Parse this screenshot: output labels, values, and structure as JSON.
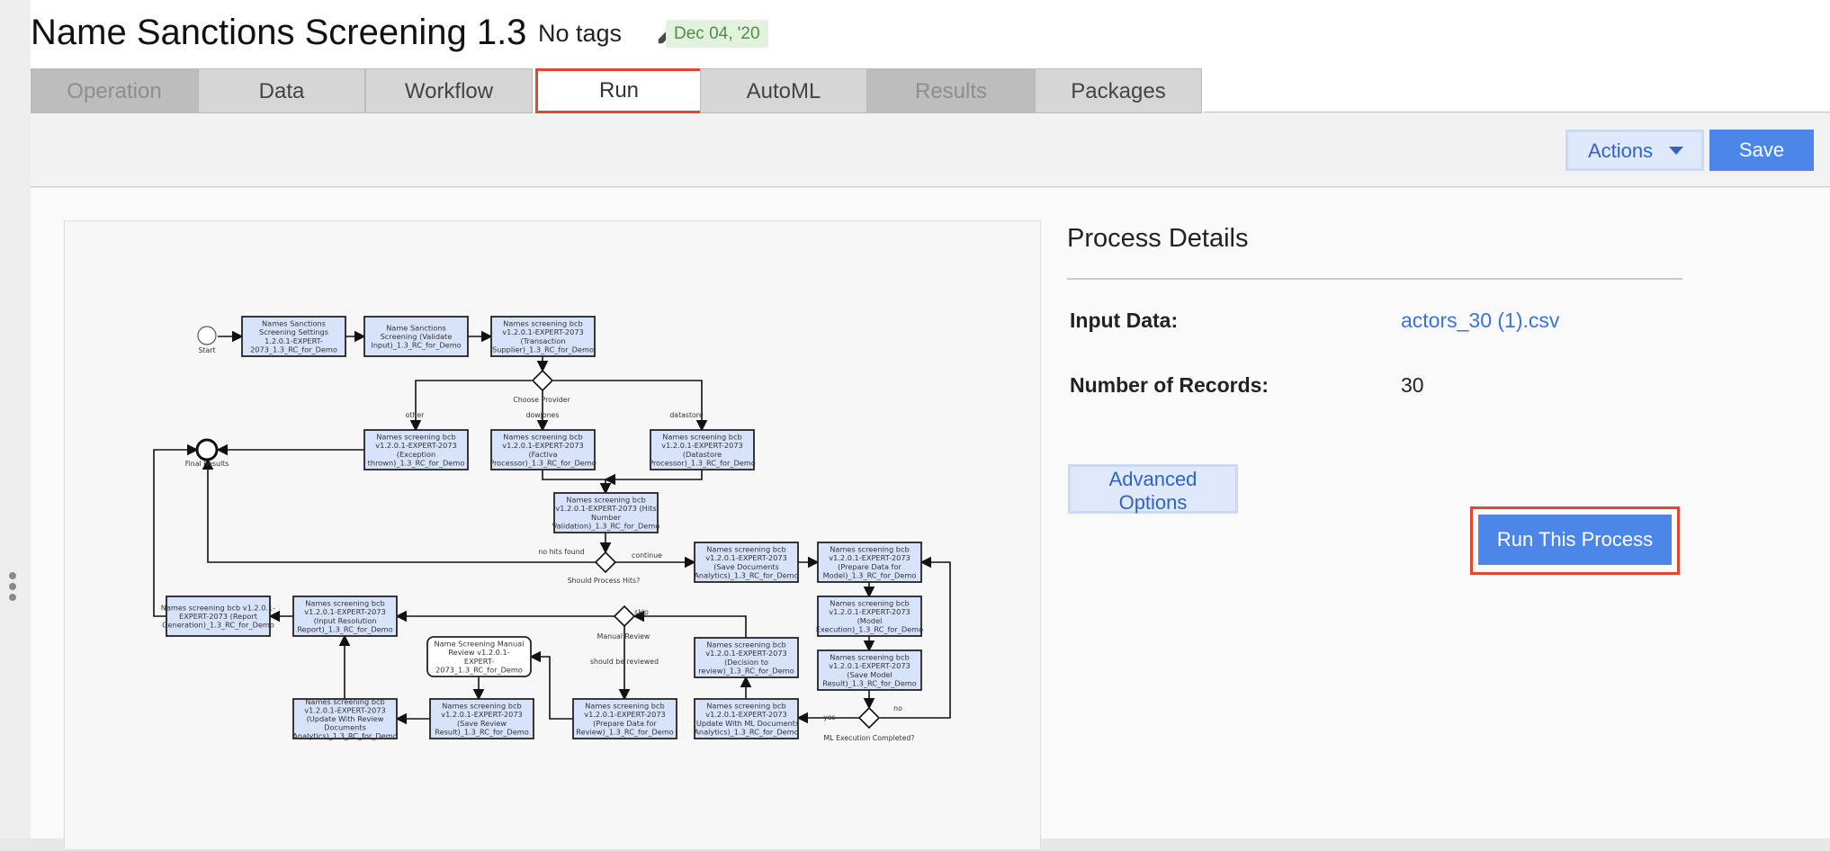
{
  "header": {
    "title": "Name Sanctions Screening 1.3",
    "tags_label": "No tags",
    "date_badge": "Dec 04, '20"
  },
  "tabs": [
    {
      "label": "Operation",
      "state": "disabled"
    },
    {
      "label": "Data",
      "state": "normal"
    },
    {
      "label": "Workflow",
      "state": "normal"
    },
    {
      "label": "Run",
      "state": "active"
    },
    {
      "label": "AutoML",
      "state": "normal"
    },
    {
      "label": "Results",
      "state": "disabled"
    },
    {
      "label": "Packages",
      "state": "normal"
    }
  ],
  "toolbar": {
    "actions_label": "Actions",
    "save_label": "Save"
  },
  "details": {
    "title": "Process Details",
    "input_label": "Input Data:",
    "input_value": "actors_30 (1).csv",
    "records_label": "Number of Records:",
    "records_value": "30",
    "advanced_label": "Advanced Options",
    "run_label": "Run This Process"
  },
  "diagram": {
    "nodes": [
      {
        "id": "settings",
        "lines": [
          "Names Sanctions",
          "Screening Settings",
          "1.2.0.1-EXPERT-",
          "2073_1.3_RC_for_Demo"
        ]
      },
      {
        "id": "validate",
        "lines": [
          "Name Sanctions",
          "Screening (Validate",
          "Input)_1.3_RC_for_Demo"
        ]
      },
      {
        "id": "transaction",
        "lines": [
          "Names screening bcb",
          "v1.2.0.1-EXPERT-2073",
          "(Transaction",
          "Supplier)_1.3_RC_for_Demo"
        ]
      },
      {
        "id": "exception",
        "lines": [
          "Names screening bcb",
          "v1.2.0.1-EXPERT-2073",
          "(Exception",
          "thrown)_1.3_RC_for_Demo"
        ]
      },
      {
        "id": "factiva",
        "lines": [
          "Names screening bcb",
          "v1.2.0.1-EXPERT-2073",
          "(Factiva",
          "Processor)_1.3_RC_for_Demo"
        ]
      },
      {
        "id": "datastore",
        "lines": [
          "Names screening bcb",
          "v1.2.0.1-EXPERT-2073",
          "(Datastore",
          "Processor)_1.3_RC_for_Demo"
        ]
      },
      {
        "id": "hits",
        "lines": [
          "Names screening bcb",
          "v1.2.0.1-EXPERT-2073 (Hits",
          "Number",
          "Validation)_1.3_RC_for_Demo"
        ]
      },
      {
        "id": "savedocs",
        "lines": [
          "Names screening bcb",
          "v1.2.0.1-EXPERT-2073",
          "(Save Documents",
          "Analytics)_1.3_RC_for_Demo"
        ]
      },
      {
        "id": "prepmodel",
        "lines": [
          "Names screening bcb",
          "v1.2.0.1-EXPERT-2073",
          "(Prepare Data for",
          "Model)_1.3_RC_for_Demo"
        ]
      },
      {
        "id": "modelexec",
        "lines": [
          "Names screening bcb",
          "v1.2.0.1-EXPERT-2073",
          "(Model",
          "Execution)_1.3_RC_for_Demo"
        ]
      },
      {
        "id": "savemodel",
        "lines": [
          "Names screening bcb",
          "v1.2.0.1-EXPERT-2073",
          "(Save Model",
          "Result)_1.3_RC_for_Demo"
        ]
      },
      {
        "id": "updateml",
        "lines": [
          "Names screening bcb",
          "v1.2.0.1-EXPERT-2073",
          "(Update With ML Documents",
          "Analytics)_1.3_RC_for_Demo"
        ]
      },
      {
        "id": "decision",
        "lines": [
          "Names screening bcb",
          "v1.2.0.1-EXPERT-2073",
          "(Decision to",
          "review)_1.3_RC_for_Demo"
        ]
      },
      {
        "id": "prepreview",
        "lines": [
          "Names screening bcb",
          "v1.2.0.1-EXPERT-2073",
          "(Prepare Data for",
          "Review)_1.3_RC_for_Demo"
        ]
      },
      {
        "id": "manual",
        "lines": [
          "Name Screening Manual",
          "Review v1.2.0.1-",
          "EXPERT-",
          "2073_1.3_RC_for_Demo"
        ]
      },
      {
        "id": "savereview",
        "lines": [
          "Names screening bcb",
          "v1.2.0.1-EXPERT-2073",
          "(Save Review",
          "Result)_1.3_RC_for_Demo"
        ]
      },
      {
        "id": "updatereview",
        "lines": [
          "Names screening bcb",
          "v1.2.0.1-EXPERT-2073",
          "(Update With Review",
          "Documents",
          "Analytics)_1.3_RC_for_Demo"
        ]
      },
      {
        "id": "inputres",
        "lines": [
          "Names screening bcb",
          "v1.2.0.1-EXPERT-2073",
          "(Input Resolution",
          "Report)_1.3_RC_for_Demo"
        ]
      },
      {
        "id": "report",
        "lines": [
          "Names screening bcb v1.2.0.1-",
          "EXPERT-2073 (Report",
          "Generation)_1.3_RC_for_Demo"
        ]
      }
    ],
    "labels": {
      "start": "Start",
      "final": "Final Results",
      "choose": "Choose Provider",
      "other": "other",
      "dowjones": "dowjones",
      "datastore": "datastore",
      "nohits": "no hits found",
      "continue": "continue",
      "should_process": "Should Process Hits?",
      "manual_review": "Manual Review",
      "skip": "skip",
      "should_reviewed": "should be reviewed",
      "ml_completed": "ML Execution Completed?",
      "yes": "yes",
      "no": "no"
    }
  }
}
